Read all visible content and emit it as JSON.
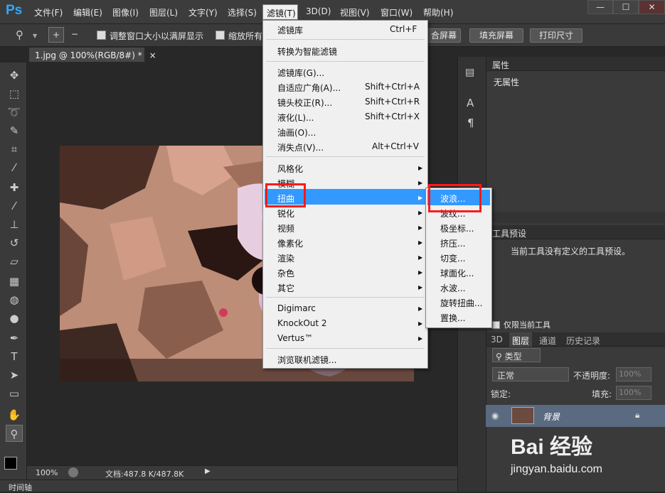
{
  "app": {
    "logo": "Ps"
  },
  "menubar": {
    "items": [
      "文件(F)",
      "编辑(E)",
      "图像(I)",
      "图层(L)",
      "文字(Y)",
      "选择(S)",
      "滤镜(T)",
      "3D(D)",
      "视图(V)",
      "窗口(W)",
      "帮助(H)"
    ],
    "active": "滤镜(T)",
    "window_buttons": [
      "—",
      "☐",
      "✕"
    ]
  },
  "options_bar": {
    "checkbox_resize": "调整窗口大小以满屏显示",
    "checkbox_zoom_all": "缩放所有",
    "buttons": [
      "合屏幕",
      "填充屏幕",
      "打印尺寸"
    ]
  },
  "document_tab": {
    "title": "1.jpg @ 100%(RGB/8#) *",
    "close": "×"
  },
  "status": {
    "zoom": "100%",
    "doc": "文档:487.8 K/487.8K"
  },
  "timeline": {
    "label": "时间轴"
  },
  "filter_menu": {
    "items": [
      {
        "label": "滤镜库",
        "shortcut": "Ctrl+F"
      },
      {
        "label": "转换为智能滤镜",
        "shortcut": ""
      },
      {
        "label": "滤镜库(G)...",
        "shortcut": ""
      },
      {
        "label": "自适应广角(A)...",
        "shortcut": "Shift+Ctrl+A"
      },
      {
        "label": "镜头校正(R)...",
        "shortcut": "Shift+Ctrl+R"
      },
      {
        "label": "液化(L)...",
        "shortcut": "Shift+Ctrl+X"
      },
      {
        "label": "油画(O)...",
        "shortcut": ""
      },
      {
        "label": "消失点(V)...",
        "shortcut": "Alt+Ctrl+V"
      },
      {
        "label": "风格化",
        "shortcut": ""
      },
      {
        "label": "模糊",
        "shortcut": ""
      },
      {
        "label": "扭曲",
        "shortcut": ""
      },
      {
        "label": "锐化",
        "shortcut": ""
      },
      {
        "label": "视频",
        "shortcut": ""
      },
      {
        "label": "像素化",
        "shortcut": ""
      },
      {
        "label": "渲染",
        "shortcut": ""
      },
      {
        "label": "杂色",
        "shortcut": ""
      },
      {
        "label": "其它",
        "shortcut": ""
      },
      {
        "label": "Digimarc",
        "shortcut": ""
      },
      {
        "label": "KnockOut 2",
        "shortcut": ""
      },
      {
        "label": "Vertus™",
        "shortcut": ""
      },
      {
        "label": "浏览联机滤镜...",
        "shortcut": ""
      }
    ],
    "highlighted": "扭曲"
  },
  "distort_submenu": {
    "items": [
      "波浪...",
      "波纹...",
      "极坐标...",
      "挤压...",
      "切变...",
      "球面化...",
      "水波...",
      "旋转扭曲...",
      "置换..."
    ],
    "highlighted": "波浪..."
  },
  "properties_panel": {
    "tab": "属性",
    "content": "无属性"
  },
  "tool_presets_panel": {
    "tab": "工具预设",
    "content": "当前工具没有定义的工具预设。",
    "checkbox": "仅限当前工具"
  },
  "layers_panel": {
    "tabs": [
      "3D",
      "图层",
      "通道",
      "历史记录"
    ],
    "active_tab": "图层",
    "filter_kind": "类型",
    "blend_mode": "正常",
    "opacity_label": "不透明度:",
    "opacity_value": "100%",
    "lock_label": "锁定:",
    "fill_label": "填充:",
    "fill_value": "100%",
    "layer_name": "背景"
  },
  "watermark": {
    "brand": "Bai 经验",
    "url": "jingyan.baidu.com"
  },
  "colors": {
    "highlight": "#3399ff",
    "red_box": "#ff1a1a"
  }
}
